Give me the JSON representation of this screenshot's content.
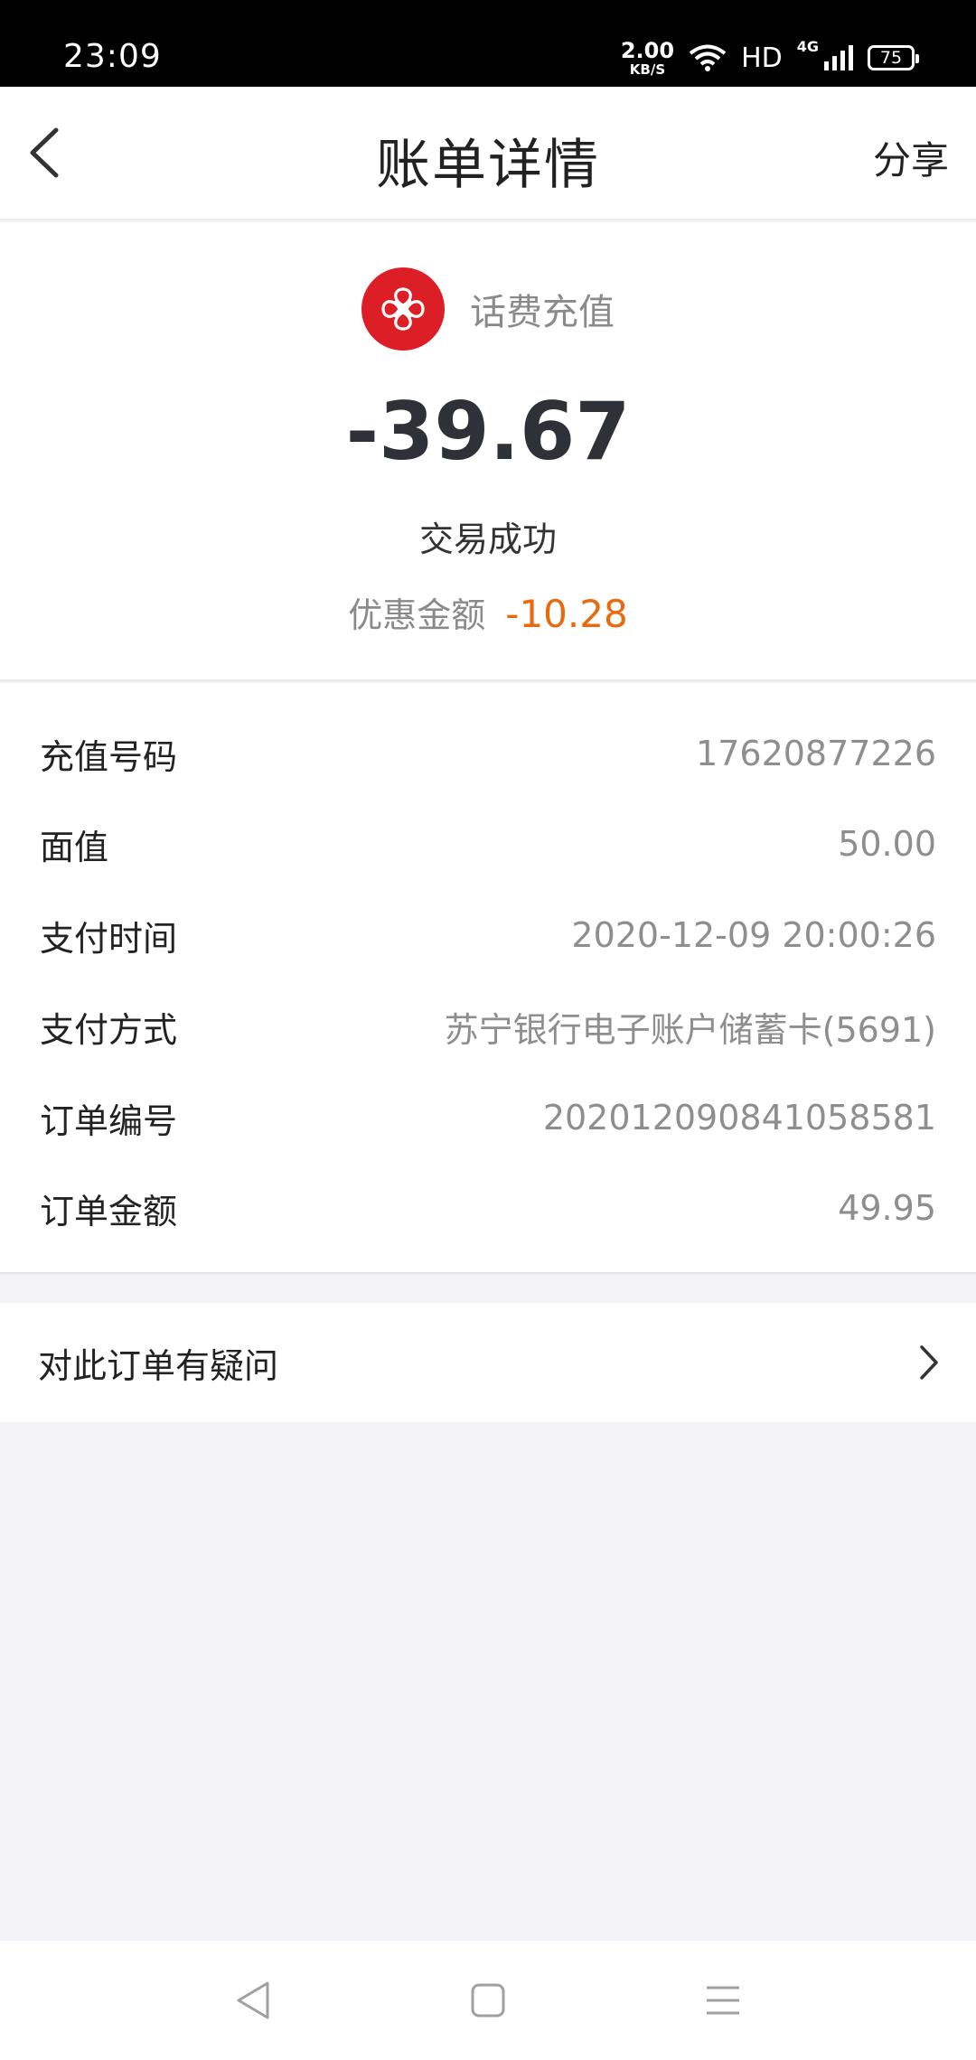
{
  "status_bar": {
    "time": "23:09",
    "net_speed_value": "2.00",
    "net_speed_unit": "KB/S",
    "hd": "HD",
    "network": "4G",
    "battery": "75"
  },
  "header": {
    "title": "账单详情",
    "share_label": "分享"
  },
  "summary": {
    "merchant_name": "话费充值",
    "amount": "-39.67",
    "status": "交易成功",
    "discount_label": "优惠金额",
    "discount_value": "-10.28",
    "colors": {
      "logo": "#dc1f26",
      "discount": "#e8690e"
    }
  },
  "details": [
    {
      "label": "充值号码",
      "value": "17620877226"
    },
    {
      "label": "面值",
      "value": "50.00"
    },
    {
      "label": "支付时间",
      "value": "2020-12-09 20:00:26"
    },
    {
      "label": "支付方式",
      "value": "苏宁银行电子账户储蓄卡(5691)"
    },
    {
      "label": "订单编号",
      "value": "2020120908410585​81"
    },
    {
      "label": "订单金额",
      "value": "49.95"
    }
  ],
  "question": {
    "label": "对此订单有疑问"
  },
  "system_nav": {
    "icons": [
      "back-triangle-icon",
      "home-square-icon",
      "menu-lines-icon"
    ]
  }
}
